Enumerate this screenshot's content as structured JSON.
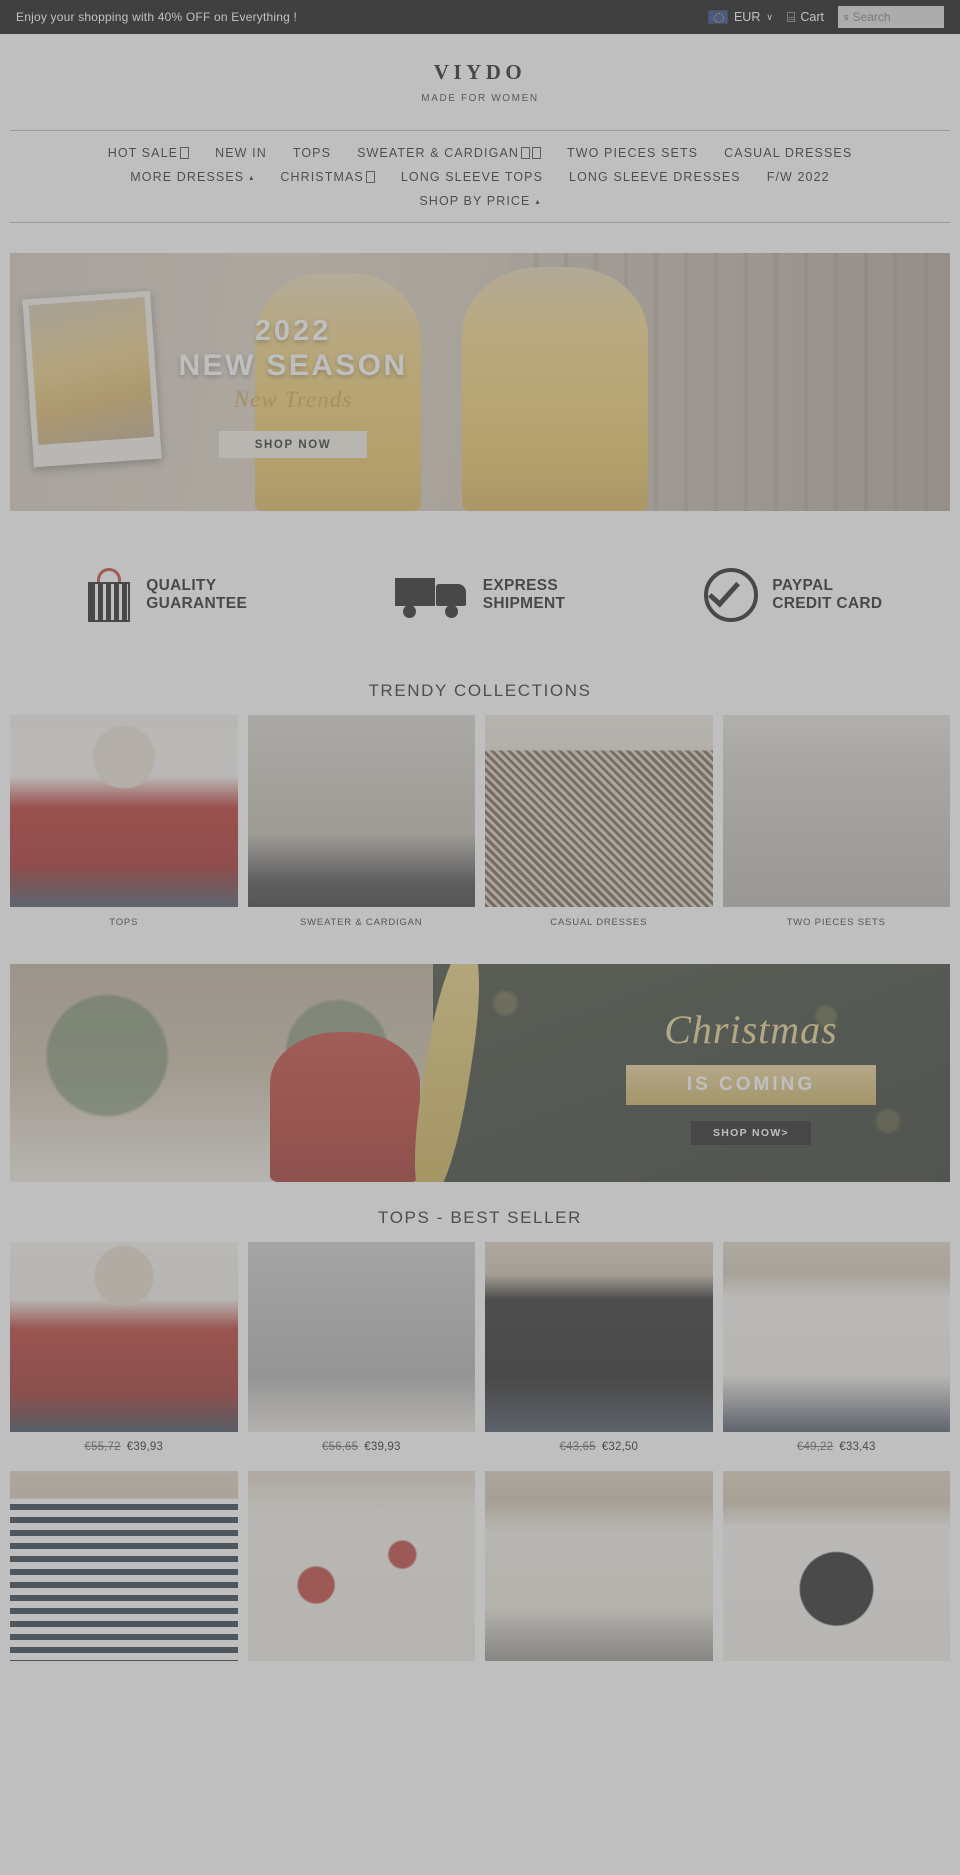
{
  "topbar": {
    "promo": "Enjoy your shopping with 40% OFF on Everything !",
    "currency": "EUR",
    "currency_chevron": "∨",
    "flag_icon": "eu-flag-icon",
    "cart_label": "Cart",
    "cart_icon": "⌸",
    "search_placeholder": "Search",
    "search_value": "",
    "search_icon": "s"
  },
  "brand": {
    "name": "VIYDO",
    "tagline": "MADE FOR WOMEN"
  },
  "nav": {
    "row1": [
      {
        "label": "HOT SALE",
        "glyphs": 1,
        "caret": false
      },
      {
        "label": "NEW IN",
        "glyphs": 0,
        "caret": false
      },
      {
        "label": "TOPS",
        "glyphs": 0,
        "caret": false
      },
      {
        "label": "SWEATER & CARDIGAN",
        "glyphs": 2,
        "caret": false
      },
      {
        "label": "TWO PIECES SETS",
        "glyphs": 0,
        "caret": false
      },
      {
        "label": "CASUAL DRESSES",
        "glyphs": 0,
        "caret": false
      }
    ],
    "row2": [
      {
        "label": "MORE DRESSES",
        "glyphs": 0,
        "caret": true
      },
      {
        "label": "CHRISTMAS",
        "glyphs": 1,
        "caret": false
      },
      {
        "label": "LONG SLEEVE TOPS",
        "glyphs": 0,
        "caret": false
      },
      {
        "label": "LONG SLEEVE DRESSES",
        "glyphs": 0,
        "caret": false
      },
      {
        "label": "F/W 2022",
        "glyphs": 0,
        "caret": false
      }
    ],
    "row3": [
      {
        "label": "SHOP BY PRICE",
        "glyphs": 0,
        "caret": true
      }
    ],
    "caret_glyph": "▴"
  },
  "hero": {
    "year": "2022",
    "season": "NEW SEASON",
    "script": "New Trends",
    "button": "SHOP NOW"
  },
  "trust": [
    {
      "icon": "shopping-bag-icon",
      "line1": "QUALITY",
      "line2": "GUARANTEE"
    },
    {
      "icon": "delivery-truck-icon",
      "line1": "EXPRESS",
      "line2": "SHIPMENT"
    },
    {
      "icon": "check-circle-icon",
      "line1": "PAYPAL",
      "line2": "CREDIT CARD"
    }
  ],
  "collections": {
    "title": "TRENDY COLLECTIONS",
    "items": [
      {
        "label": "TOPS",
        "img": "img-tops"
      },
      {
        "label": "SWEATER & CARDIGAN",
        "img": "img-sweater"
      },
      {
        "label": "CASUAL DRESSES",
        "img": "img-dress"
      },
      {
        "label": "TWO PIECES SETS",
        "img": "img-twopiece"
      }
    ]
  },
  "xmas_banner": {
    "script": "Christmas",
    "ribbon": "IS COMING",
    "button": "SHOP NOW>"
  },
  "bestseller": {
    "title": "TOPS - BEST SELLER",
    "items": [
      {
        "img": "img-santa",
        "price_old": "€55,72",
        "price_new": "€39,93"
      },
      {
        "img": "img-hoodie",
        "price_old": "€56,65",
        "price_new": "€39,93"
      },
      {
        "img": "img-blacktee",
        "price_old": "€43,65",
        "price_new": "€32,50"
      },
      {
        "img": "img-whitetee",
        "price_old": "€49,22",
        "price_new": "€33,43"
      }
    ],
    "row2": [
      {
        "img": "img-stripe"
      },
      {
        "img": "img-floral"
      },
      {
        "img": "img-vneck"
      },
      {
        "img": "img-cat"
      }
    ]
  }
}
